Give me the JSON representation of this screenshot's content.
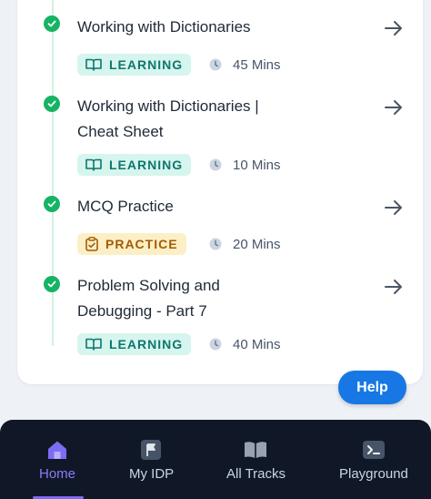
{
  "lessons": [
    {
      "title_line1": "Working with Dictionaries",
      "title_line2": "",
      "type": "LEARNING",
      "duration": "45 Mins"
    },
    {
      "title_line1": "Working with Dictionaries |",
      "title_line2": "Cheat Sheet",
      "type": "LEARNING",
      "duration": "10 Mins"
    },
    {
      "title_line1": "MCQ Practice",
      "title_line2": "",
      "type": "PRACTICE",
      "duration": "20 Mins"
    },
    {
      "title_line1": "Problem Solving and",
      "title_line2": "Debugging - Part 7",
      "type": "LEARNING",
      "duration": "40 Mins"
    }
  ],
  "help": {
    "label": "Help"
  },
  "nav": {
    "items": [
      {
        "label": "Home",
        "icon": "home-icon",
        "active": true
      },
      {
        "label": "My IDP",
        "icon": "flag-icon",
        "active": false
      },
      {
        "label": "All Tracks",
        "icon": "book-icon",
        "active": false
      },
      {
        "label": "Playground",
        "icon": "terminal-icon",
        "active": false
      }
    ]
  },
  "colors": {
    "check": "#16b364",
    "learning_bg": "#d6f5ee",
    "learning_text": "#0f766e",
    "practice_bg": "#fdefc5",
    "practice_text": "#a15c07",
    "help_bg": "#1778e5",
    "nav_bg": "#101828",
    "nav_active": "#8b7cf6"
  }
}
